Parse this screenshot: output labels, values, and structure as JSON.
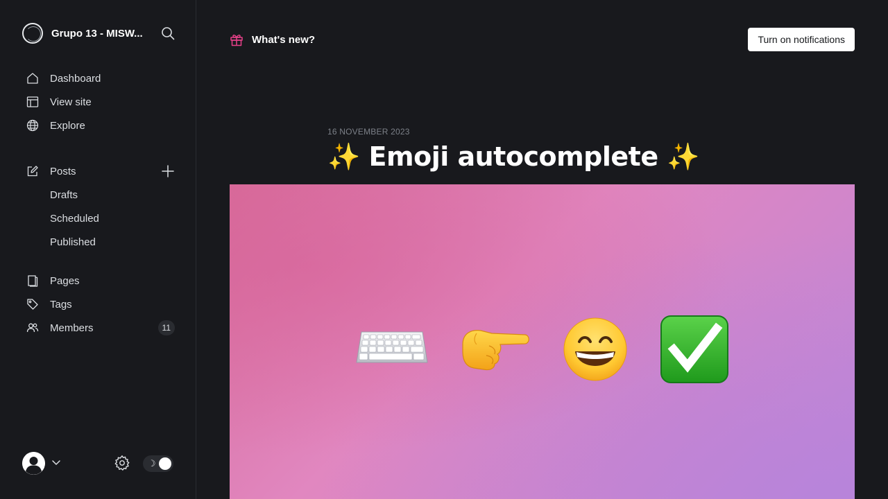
{
  "sidebar": {
    "brand_title": "Grupo 13 - MISW...",
    "nav_primary": [
      {
        "label": "Dashboard",
        "icon": "home-icon"
      },
      {
        "label": "View site",
        "icon": "layout-icon"
      },
      {
        "label": "Explore",
        "icon": "globe-icon"
      }
    ],
    "posts": {
      "label": "Posts",
      "icon": "edit-icon"
    },
    "posts_sub": [
      "Drafts",
      "Scheduled",
      "Published"
    ],
    "nav_secondary": [
      {
        "label": "Pages",
        "icon": "page-icon"
      },
      {
        "label": "Tags",
        "icon": "tag-icon"
      },
      {
        "label": "Members",
        "icon": "members-icon",
        "badge": "11"
      }
    ]
  },
  "header": {
    "whats_new": "What's new?",
    "notify_button": "Turn on notifications"
  },
  "post": {
    "date": "16 NOVEMBER 2023",
    "title": "✨ Emoji autocomplete ✨",
    "hero_emojis": [
      "keyboard-icon",
      "pointing-right-icon",
      "grinning-face-icon",
      "check-mark-icon"
    ]
  },
  "colors": {
    "background": "#18191d",
    "accent_pink": "#e8418a",
    "check_green": "#2fb52b"
  }
}
